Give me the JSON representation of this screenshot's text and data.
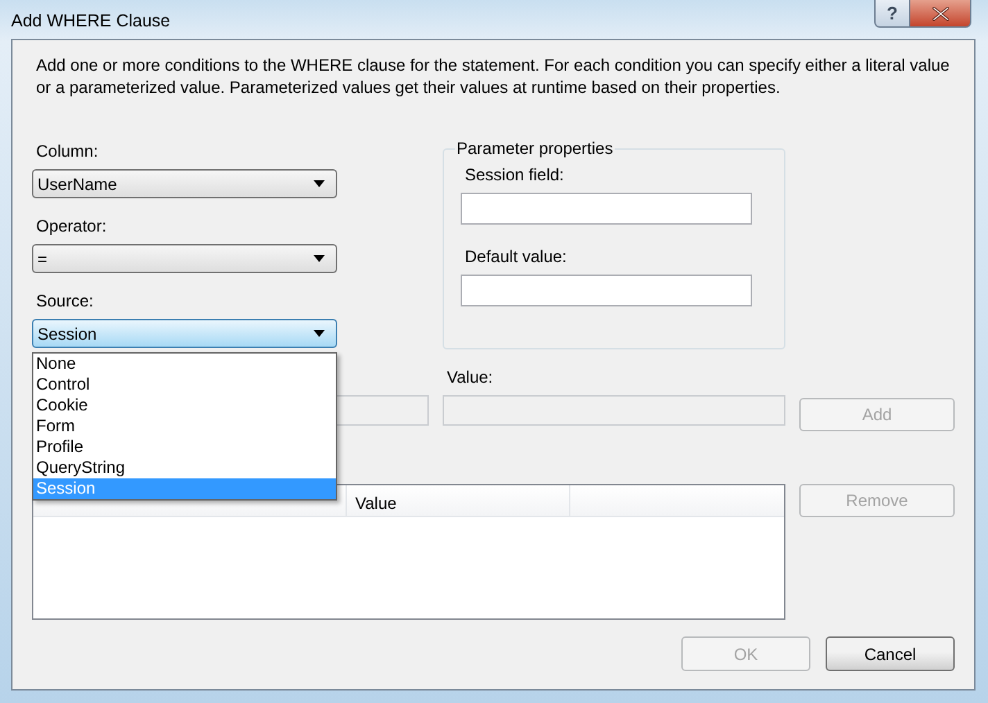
{
  "window": {
    "title": "Add WHERE Clause",
    "help_button": "?"
  },
  "description": "Add one or more conditions to the WHERE clause for the statement. For each condition you can specify either a literal value or a parameterized value. Parameterized values get their values at runtime based on their properties.",
  "combos": [
    {
      "label": "Column:",
      "value": "UserName",
      "focused": false
    },
    {
      "label": "Operator:",
      "value": "=",
      "focused": false
    },
    {
      "label": "Source:",
      "value": "Session",
      "focused": true
    }
  ],
  "source_options": [
    {
      "label": "None",
      "selected": false
    },
    {
      "label": "Control",
      "selected": false
    },
    {
      "label": "Cookie",
      "selected": false
    },
    {
      "label": "Form",
      "selected": false
    },
    {
      "label": "Profile",
      "selected": false
    },
    {
      "label": "QueryString",
      "selected": false
    },
    {
      "label": "Session",
      "selected": true
    }
  ],
  "parameter_properties": {
    "title": "Parameter properties",
    "fields": [
      {
        "label": "Session field:"
      },
      {
        "label": "Default value:"
      }
    ]
  },
  "parameter_field": {
    "disabled": true
  },
  "value_field": {
    "label": "Value:",
    "disabled": true
  },
  "add_button": {
    "label": "Add",
    "disabled": true
  },
  "table": {
    "columns": [
      {
        "label": "Value"
      }
    ]
  },
  "remove_button": {
    "label": "Remove",
    "disabled": true
  },
  "footer_buttons": [
    {
      "label": "OK",
      "disabled": true
    },
    {
      "label": "Cancel",
      "disabled": false
    }
  ]
}
